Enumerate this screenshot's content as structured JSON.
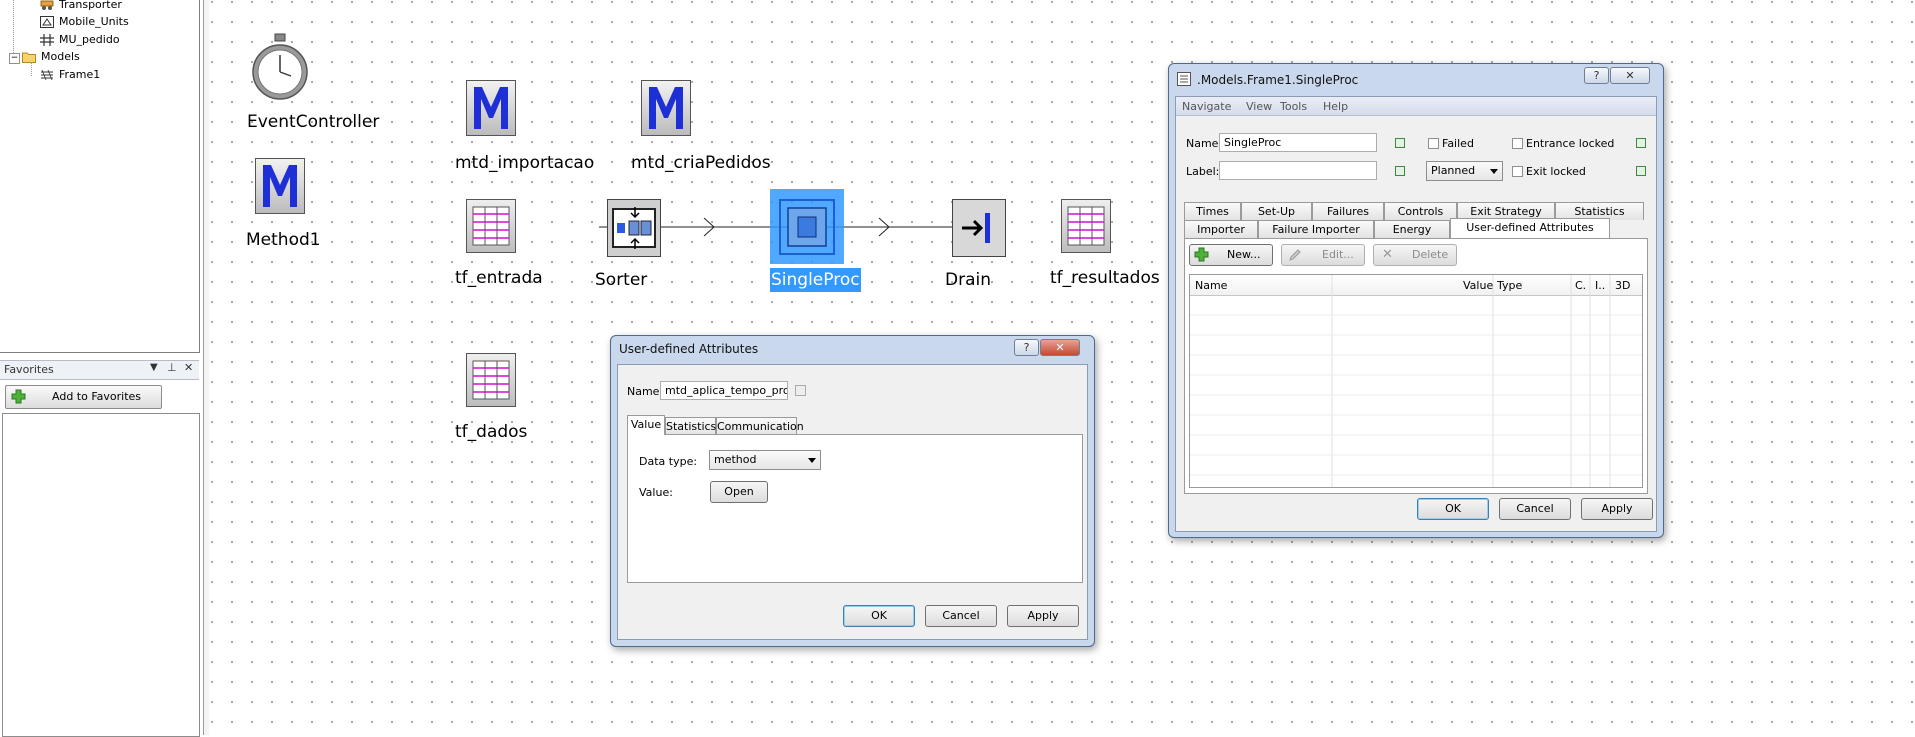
{
  "tree": {
    "items": [
      {
        "label": "Transporter",
        "icon": "transporter-icon"
      },
      {
        "label": "Mobile_Units",
        "icon": "mobile-units-icon"
      },
      {
        "label": "MU_pedido",
        "icon": "grid-icon"
      },
      {
        "label": "Models",
        "icon": "folder-icon"
      },
      {
        "label": "Frame1",
        "icon": "frame-icon"
      }
    ]
  },
  "favorites": {
    "title": "Favorites",
    "add_button": "Add to Favorites"
  },
  "canvas": {
    "nodes": {
      "event_controller": "EventController",
      "method1": "Method1",
      "mtd_importacao": "mtd_importacao",
      "mtd_criapedidos": "mtd_criaPedidos",
      "tf_entrada": "tf_entrada",
      "sorter": "Sorter",
      "singleproc": "SingleProc",
      "drain": "Drain",
      "tf_resultados": "tf_resultados",
      "tf_dados": "tf_dados"
    }
  },
  "uda_dialog": {
    "title": "User-defined Attributes",
    "help": "?",
    "close": "✕",
    "name_label": "Name:",
    "name_value": "mtd_aplica_tempo_proc",
    "tabs": [
      "Value",
      "Statistics",
      "Communication"
    ],
    "data_type_label": "Data type:",
    "data_type_value": "method",
    "value_label": "Value:",
    "open_button": "Open",
    "ok": "OK",
    "cancel": "Cancel",
    "apply": "Apply"
  },
  "proc_dialog": {
    "title": ".Models.Frame1.SingleProc",
    "help": "?",
    "close": "✕",
    "menu": [
      "Navigate",
      "View",
      "Tools",
      "Help"
    ],
    "name_label": "Name:",
    "name_value": "SingleProc",
    "label_label": "Label:",
    "label_value": "",
    "failed": "Failed",
    "planned": "Planned",
    "entrance_locked": "Entrance locked",
    "exit_locked": "Exit locked",
    "tabs_row1": [
      "Times",
      "Set-Up",
      "Failures",
      "Controls",
      "Exit Strategy",
      "Statistics"
    ],
    "tabs_row2": [
      "Importer",
      "Failure Importer",
      "Energy",
      "User-defined Attributes"
    ],
    "new_button": "New...",
    "edit_button": "Edit...",
    "delete_button": "Delete",
    "columns": [
      "Name",
      "Value",
      "Type",
      "C.",
      "I..",
      "3D"
    ],
    "ok": "OK",
    "cancel": "Cancel",
    "apply": "Apply"
  },
  "colors": {
    "selection": "#3399ff",
    "method_blue": "#1f2fd6",
    "table_magenta": "#d40fd4"
  }
}
